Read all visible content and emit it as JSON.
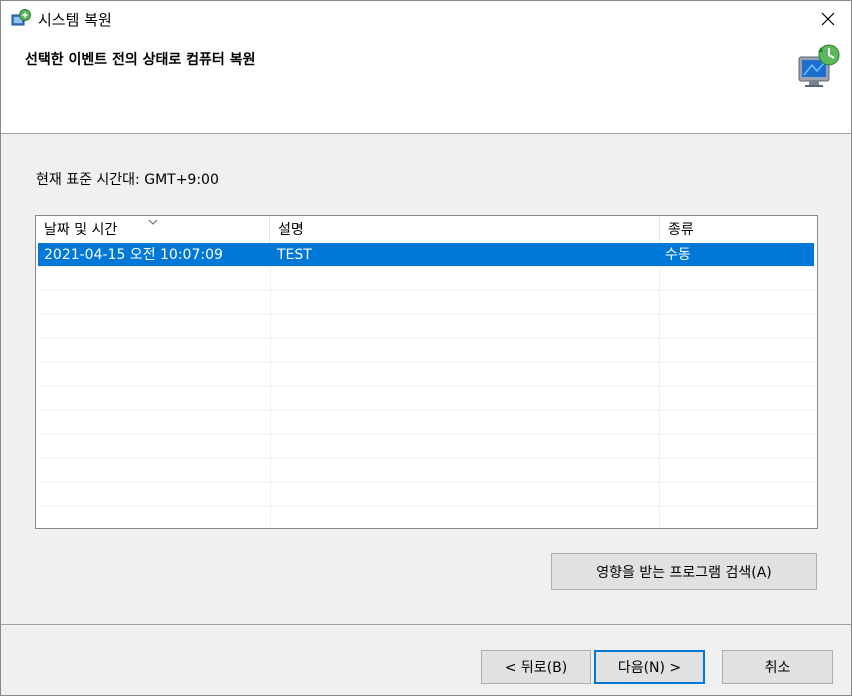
{
  "window": {
    "title": "시스템 복원"
  },
  "header": {
    "title": "선택한 이벤트 전의 상태로 컴퓨터 복원"
  },
  "timezone": {
    "label": "현재 표준 시간대: GMT+9:00"
  },
  "list": {
    "columns": [
      "날짜 및 시간",
      "설명",
      "종류"
    ],
    "rows": [
      {
        "date": "2021-04-15 오전 10:07:09",
        "description": "TEST",
        "type": "수동",
        "selected": true
      }
    ]
  },
  "buttons": {
    "scan": "영향을 받는 프로그램 검색(A)",
    "back": "< 뒤로(B)",
    "next": "다음(N) >",
    "cancel": "취소"
  },
  "colors": {
    "selection": "#0078d7"
  },
  "icons": {
    "title": "system-restore-icon",
    "header": "computer-restore-icon",
    "close": "close-icon"
  }
}
